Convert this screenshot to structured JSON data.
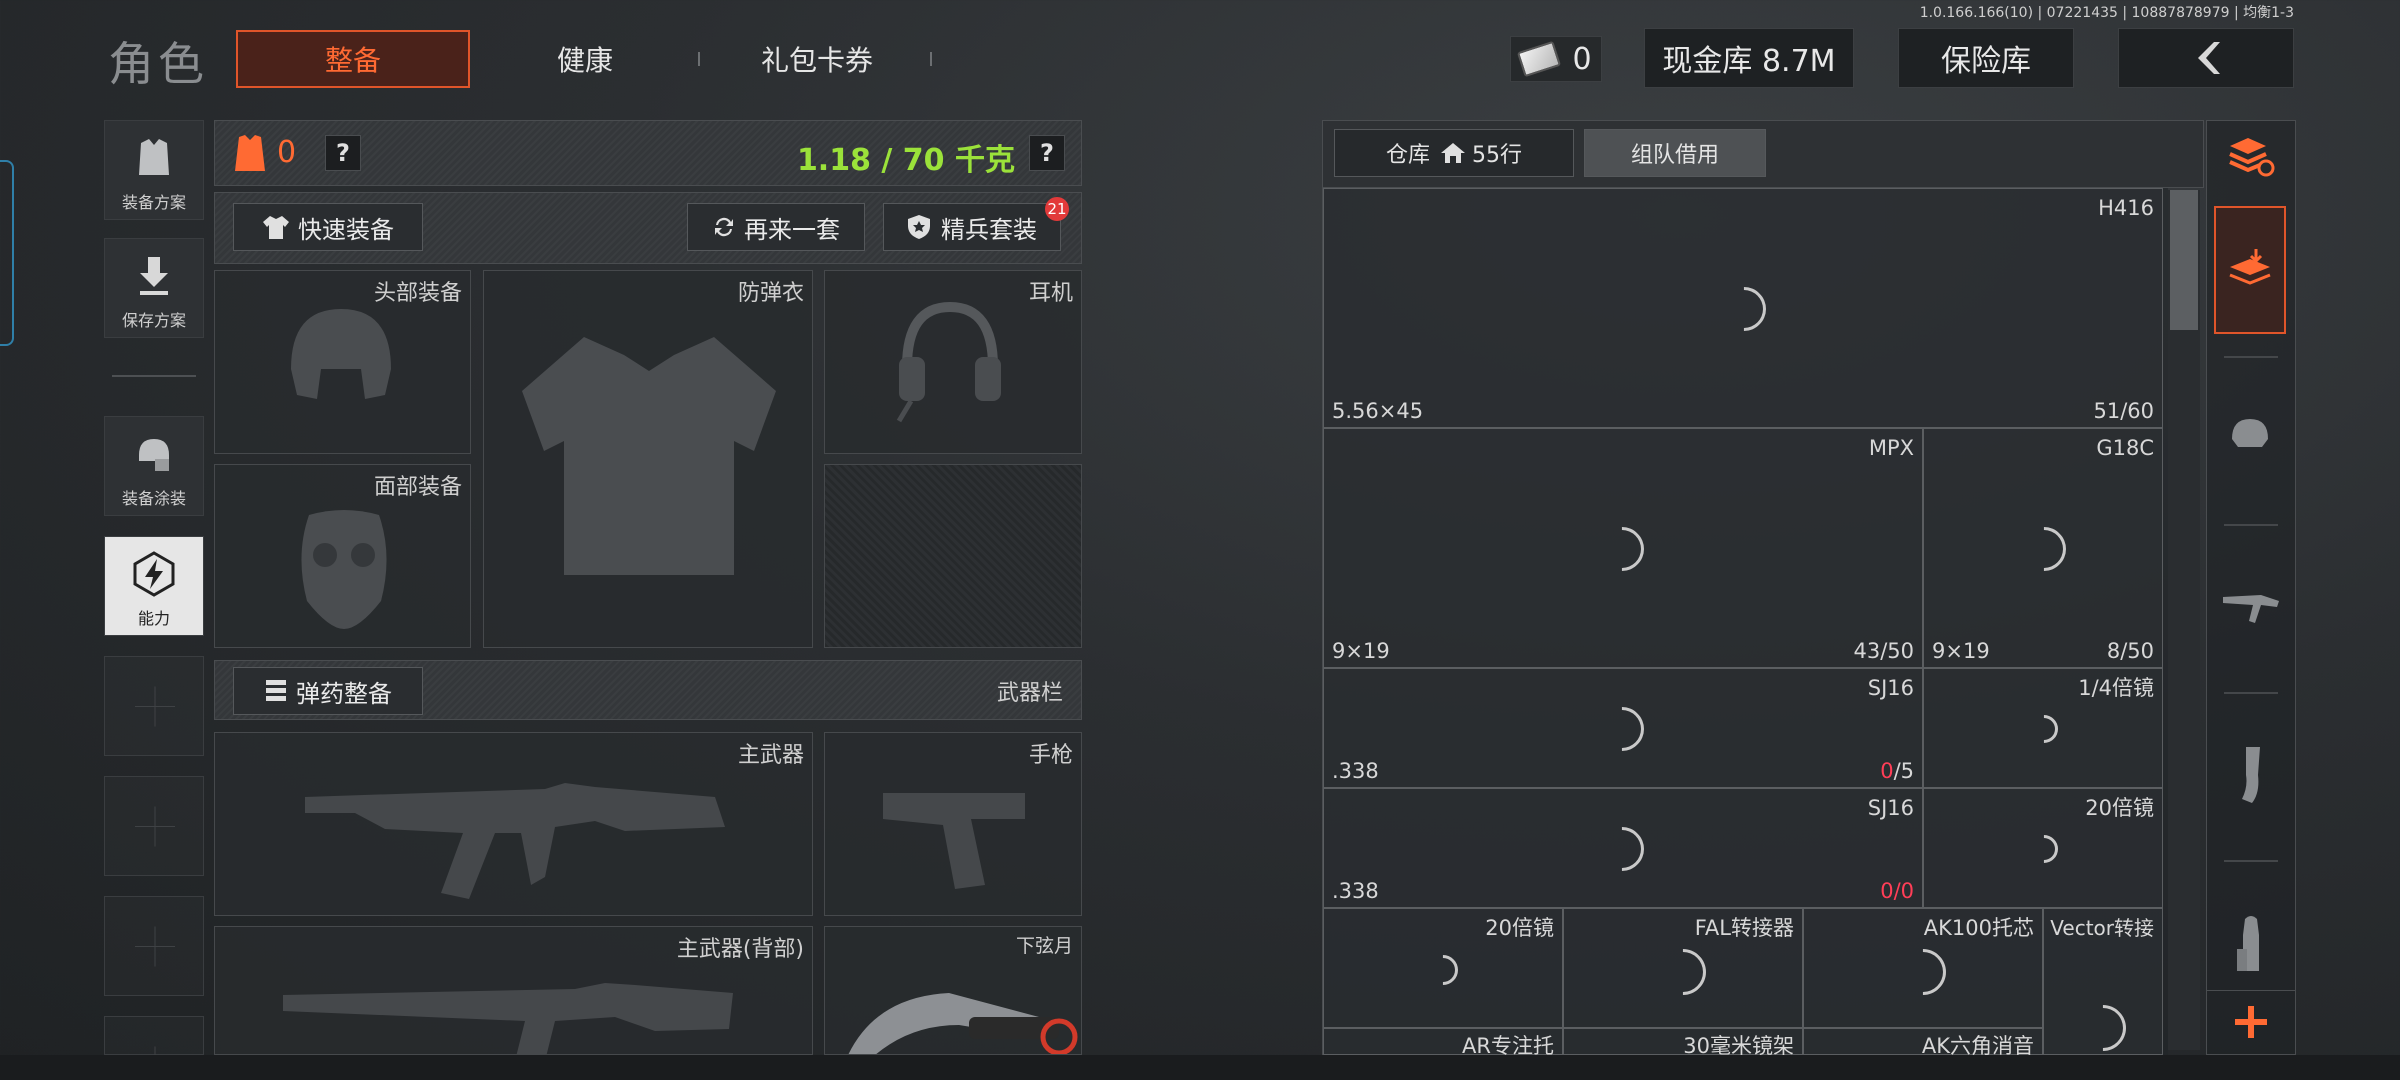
{
  "version": "1.0.166.166(10) | 07221435 | 10887878979 | 均衡1-3",
  "brand": "角色",
  "tabs": [
    "整备",
    "健康",
    "礼包卡券"
  ],
  "currency": {
    "cash": "0",
    "stash": "现金库 8.7M",
    "vault": "保险库"
  },
  "icons": {
    "back": "back-arrow-icon",
    "cash": "cash-bill-icon"
  },
  "left_menu": [
    {
      "label": "装备方案",
      "icon": "vest-icon"
    },
    {
      "label": "保存方案",
      "icon": "download-icon"
    },
    {
      "label": "装备涂装",
      "icon": "helmet-paint-icon"
    },
    {
      "label": "能力",
      "icon": "lightning-hex-icon"
    }
  ],
  "equip": {
    "armor_count": "0",
    "weight": "1.18 / 70 千克",
    "help": "?",
    "quick_equip": "快速装备",
    "again": "再来一套",
    "elite": "精兵套装",
    "elite_badge": "21",
    "slots": {
      "head": "头部装备",
      "armor": "防弹衣",
      "ear": "耳机",
      "face": "面部装备",
      "main": "主武器",
      "pistol": "手枪",
      "main_back": "主武器(背部)",
      "knife": "下弦月"
    },
    "ammo_btn": "弹药整备",
    "weapon_bar": "武器栏"
  },
  "warehouse": {
    "tab_storage": "仓库",
    "tab_storage_rows": "55行",
    "tab_team": "组队借用",
    "items": [
      {
        "name": "H416",
        "caliber": "5.56×45",
        "count": "51/60"
      },
      {
        "name": "MPX",
        "caliber": "9×19",
        "count": "43/50"
      },
      {
        "name": "G18C",
        "caliber": "9×19",
        "count": "8/50"
      },
      {
        "name": "SJ16",
        "caliber": ".338",
        "count_a": "0",
        "count_b": "/5"
      },
      {
        "name": "1/4倍镜"
      },
      {
        "name": "SJ16",
        "caliber": ".338",
        "count_a": "0",
        "count_b": "/0"
      },
      {
        "name": "20倍镜"
      },
      {
        "name": "20倍镜"
      },
      {
        "name": "FAL转接器"
      },
      {
        "name": "AK100托芯"
      },
      {
        "name": "Vector转接"
      },
      {
        "name": "AR专注托"
      },
      {
        "name": "30毫米镜架"
      },
      {
        "name": "AK六角消音"
      }
    ]
  },
  "colors": {
    "accent": "#ff6a33",
    "weight_green": "#9be23a",
    "badge_red": "#e23a3a",
    "count_red": "#ff3e57"
  }
}
